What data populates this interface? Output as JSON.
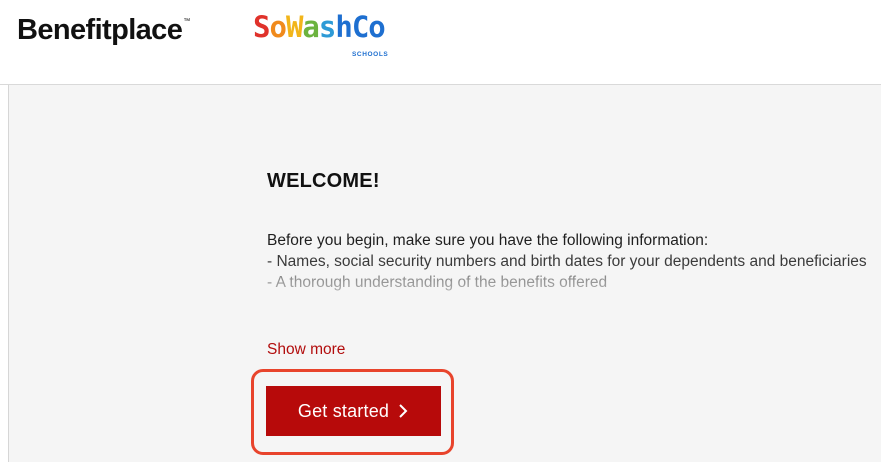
{
  "header": {
    "brand": "Benefitplace",
    "brand_mark": "™",
    "partner_logo": {
      "letters": [
        "S",
        "o",
        "W",
        "a",
        "s",
        "h",
        "C",
        "o"
      ],
      "colors": [
        "#e0322b",
        "#f08a1c",
        "#f2b51a",
        "#6cb33f",
        "#2d9ad6",
        "#1e6fd0",
        "#1e6fd0",
        "#1e6fd0"
      ],
      "subtitle": "SCHOOLS"
    }
  },
  "main": {
    "heading": "WELCOME!",
    "intro": "Before you begin, make sure you have the following information:",
    "bullets": [
      "- Names, social security numbers and birth dates for your dependents and beneficiaries",
      "- A thorough understanding of the benefits offered"
    ],
    "show_more": "Show more",
    "cta_label": "Get started",
    "cta_icon": "chevron-right-icon"
  },
  "colors": {
    "accent": "#b70a0a",
    "highlight_ring": "#e8442c",
    "page_bg": "#f5f5f5"
  }
}
